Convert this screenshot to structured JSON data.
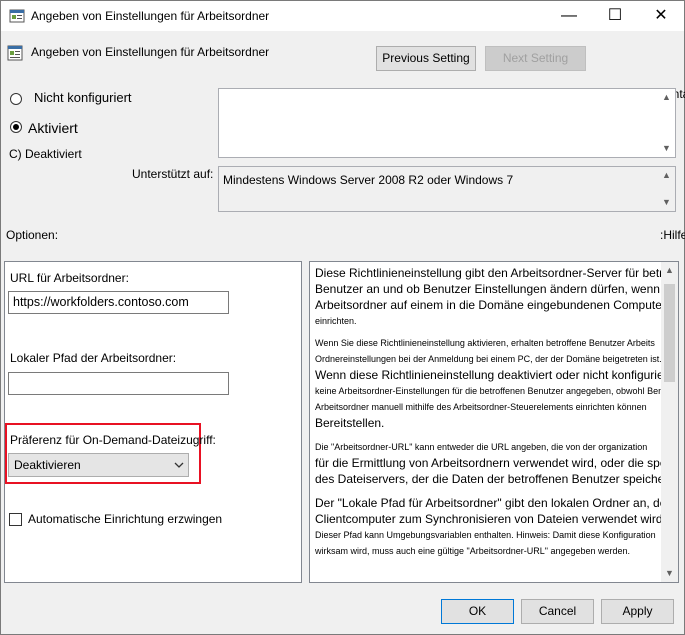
{
  "window": {
    "title": "Angeben von Einstellungen für Arbeitsordner",
    "minimize_glyph": "—",
    "maximize_glyph": "☐",
    "close_glyph": "✕"
  },
  "header": {
    "policy_title": "Angeben von Einstellungen für Arbeitsordner",
    "previous_label": "Previous Setting",
    "next_label": "Next Setting"
  },
  "state": {
    "not_configured": "Nicht konfiguriert",
    "enabled": "Aktiviert",
    "disabled": "C) Deaktiviert",
    "selected": "enabled"
  },
  "comment": {
    "label": ":Kommentar",
    "value": ""
  },
  "supported": {
    "label": "Unterstützt auf:",
    "value": "Mindestens Windows Server 2008 R2 oder Windows 7"
  },
  "options": {
    "label": "Optionen:",
    "url_label": "URL für Arbeitsordner:",
    "url_value": "https://workfolders.contoso.com",
    "local_path_label": "Lokaler Pfad der Arbeitsordner:",
    "local_path_value": "",
    "ondemand_label": "Präferenz für On-Demand-Dateizugriff:",
    "ondemand_value": "Deaktivieren",
    "force_setup_label": "Automatische Einrichtung erzwingen",
    "force_setup_checked": false,
    "highlight_color": "#e81123"
  },
  "help": {
    "label": ":Hilfe",
    "lines": [
      {
        "size": "big",
        "text": "Diese Richtlinieneinstellung gibt den Arbeitsordner-Server für betroffene"
      },
      {
        "size": "big",
        "text": "Benutzer an und ob Benutzer Einstellungen ändern dürfen, wenn sie"
      },
      {
        "size": "big",
        "text": "Arbeitsordner auf einem in die Domäne eingebundenen Computer"
      },
      {
        "size": "small",
        "text": "einrichten."
      },
      {
        "size": "small",
        "text": "              Wenn Sie diese Richtlinieneinstellung aktivieren, erhalten betroffene Benutzer Arbeits"
      },
      {
        "size": "small",
        "text": "Ordnereinstellungen bei der Anmeldung bei einem PC, der der Domäne beigetreten ist."
      },
      {
        "size": "big",
        "text": "Wenn diese Richtlinieneinstellung deaktiviert oder nicht konfiguriert ist, werden"
      },
      {
        "size": "small",
        "text": "keine Arbeitsordner-Einstellungen für die betroffenen Benutzer angegeben, obwohl Benutzer"
      },
      {
        "size": "small",
        "text": "Arbeitsordner manuell mithilfe des Arbeitsordner-Steuerelements einrichten können"
      },
      {
        "size": "big",
        "text": "Bereitstellen."
      },
      {
        "size": "small",
        "text": "              Die \"Arbeitsordner-URL\" kann entweder die URL angeben, die von der organization"
      },
      {
        "size": "big",
        "text": "für die Ermittlung von Arbeitsordnern verwendet wird, oder die spezifische URL"
      },
      {
        "size": "big",
        "text": "des Dateiservers, der die Daten der betroffenen Benutzer speichert."
      },
      {
        "size": "big",
        "text": "Der \"Lokale Pfad für Arbeitsordner\" gibt den lokalen Ordner an, der auf dem"
      },
      {
        "size": "big",
        "text": "Clientcomputer zum Synchronisieren von Dateien verwendet wird."
      },
      {
        "size": "small",
        "text": "Dieser Pfad kann Umgebungsvariablen enthalten. Hinweis: Damit diese Konfiguration"
      },
      {
        "size": "small",
        "text": "wirksam wird, muss auch eine gültige \"Arbeitsordner-URL\" angegeben werden."
      }
    ]
  },
  "footer": {
    "ok_label": "OK",
    "cancel_label": "Cancel",
    "apply_label": "Apply"
  }
}
